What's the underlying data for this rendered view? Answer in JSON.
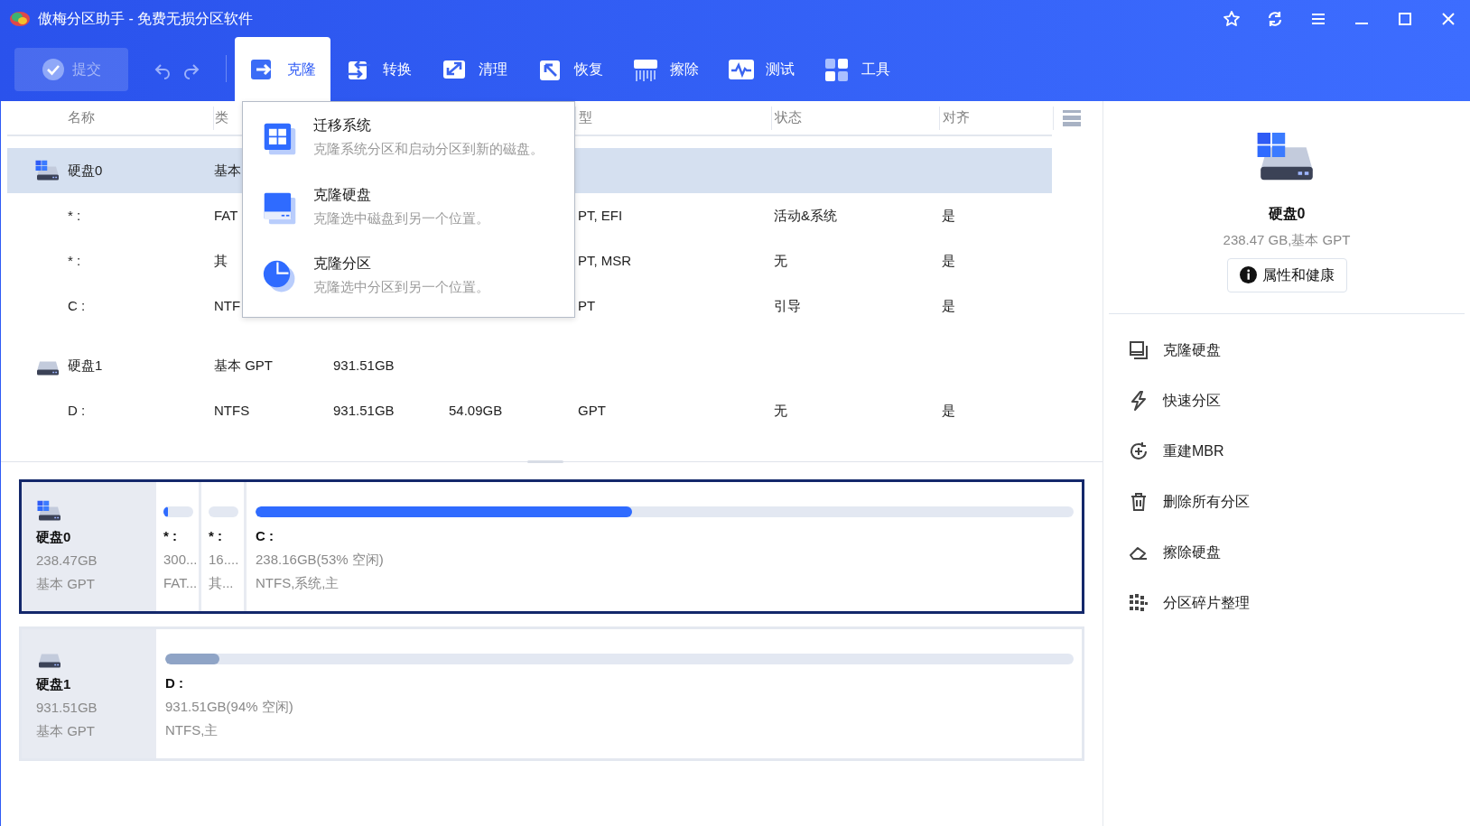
{
  "window": {
    "title": "傲梅分区助手 - 免费无损分区软件"
  },
  "toolbar": {
    "commit": {
      "label": "提交",
      "disabled": true
    },
    "tabs": [
      {
        "label": "克隆",
        "kind": "clone",
        "selected": true
      },
      {
        "label": "转换",
        "kind": "convert",
        "selected": false
      },
      {
        "label": "清理",
        "kind": "clean",
        "selected": false
      },
      {
        "label": "恢复",
        "kind": "recover",
        "selected": false
      },
      {
        "label": "擦除",
        "kind": "wipe",
        "selected": false
      },
      {
        "label": "测试",
        "kind": "test",
        "selected": false
      },
      {
        "label": "工具",
        "kind": "tools",
        "selected": false
      }
    ]
  },
  "clone_menu": {
    "items": [
      {
        "kind": "migrate",
        "title": "迁移系统",
        "description": "克隆系统分区和启动分区到新的磁盘。"
      },
      {
        "kind": "disk",
        "title": "克隆硬盘",
        "description": "克隆选中磁盘到另一个位置。"
      },
      {
        "kind": "partition",
        "title": "克隆分区",
        "description": "克隆选中分区到另一个位置。"
      }
    ]
  },
  "table": {
    "columns": [
      "名称",
      "类",
      null,
      null,
      "型",
      "状态",
      "对齐"
    ],
    "rows": [
      {
        "kind": "disk",
        "system": true,
        "selected": true,
        "cells": [
          "硬盘0",
          "基本",
          null,
          null,
          null,
          null,
          null
        ]
      },
      {
        "kind": "partition",
        "cells": [
          "* :",
          "FAT",
          null,
          null,
          "PT, EFI",
          "活动&系统",
          "是"
        ]
      },
      {
        "kind": "partition",
        "cells": [
          "* :",
          "其",
          null,
          null,
          "PT, MSR",
          "无",
          "是"
        ]
      },
      {
        "kind": "partition",
        "cells": [
          "C :",
          "NTF",
          null,
          null,
          "PT",
          "引导",
          "是"
        ]
      },
      {
        "kind": "disk",
        "system": false,
        "selected": false,
        "cells": [
          "硬盘1",
          "基本 GPT",
          "931.51GB",
          null,
          null,
          null,
          null
        ]
      },
      {
        "kind": "partition",
        "cells": [
          "D :",
          "NTFS",
          "931.51GB",
          "54.09GB",
          "GPT",
          "无",
          "是"
        ]
      }
    ]
  },
  "disk_map": [
    {
      "name": "硬盘0",
      "size": "238.47GB",
      "style": "基本 GPT",
      "system": true,
      "selected": true,
      "partitions": [
        {
          "label": "* :",
          "size": "300...",
          "info": "FAT...",
          "level": 0.15
        },
        {
          "label": "* :",
          "size": "16....",
          "info": "其...",
          "level": 0
        },
        {
          "label": "C :",
          "size": "238.16GB(53% 空闲)",
          "info": "NTFS,系统,主",
          "level": 0.46
        }
      ]
    },
    {
      "name": "硬盘1",
      "size": "931.51GB",
      "style": "基本 GPT",
      "system": false,
      "selected": false,
      "partitions": [
        {
          "label": "D :",
          "size": "931.51GB(94% 空闲)",
          "info": "NTFS,主",
          "level": 0.06
        }
      ]
    }
  ],
  "details": {
    "name": "硬盘0",
    "summary": "238.47 GB,基本 GPT",
    "button": "属性和健康",
    "actions": [
      {
        "kind": "clone",
        "label": "克隆硬盘"
      },
      {
        "kind": "quick",
        "label": "快速分区"
      },
      {
        "kind": "mbr",
        "label": "重建MBR"
      },
      {
        "kind": "delete",
        "label": "删除所有分区"
      },
      {
        "kind": "wipe",
        "label": "擦除硬盘"
      },
      {
        "kind": "defrag",
        "label": "分区碎片整理"
      }
    ]
  }
}
